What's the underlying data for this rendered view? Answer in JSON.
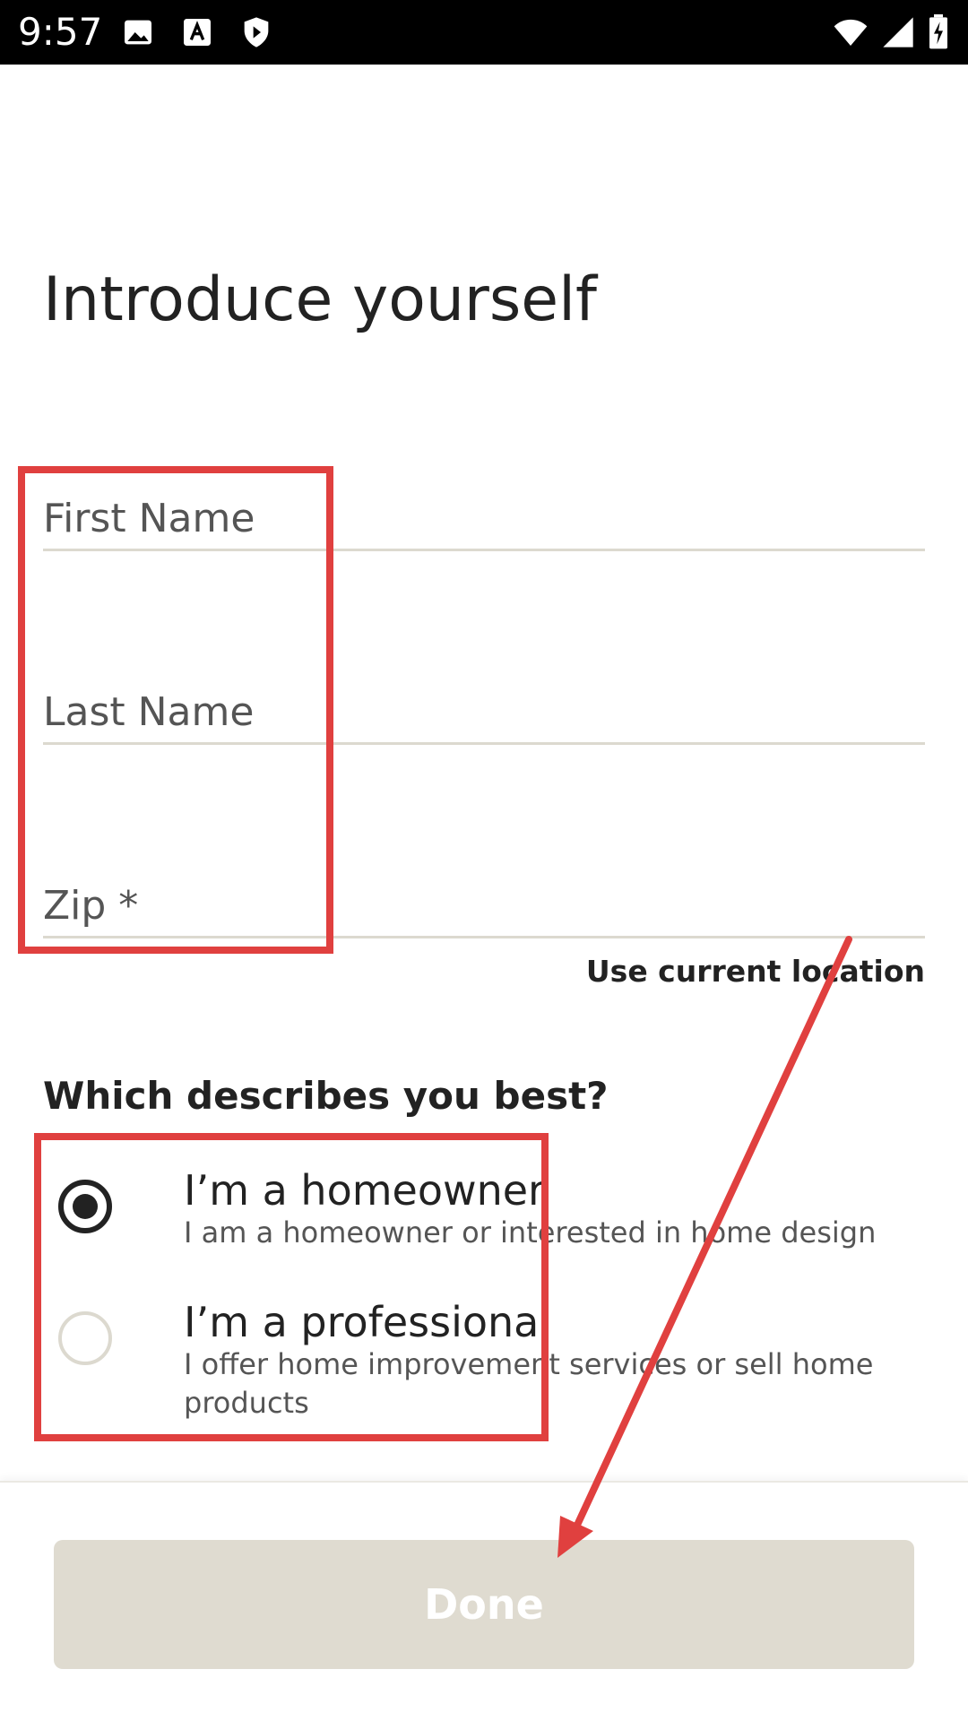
{
  "status_bar": {
    "time": "9:57",
    "left_icons": [
      "image-icon",
      "text-a-icon",
      "shield-play-icon"
    ],
    "right_icons": [
      "wifi-icon",
      "signal-icon",
      "battery-charging-icon"
    ]
  },
  "page": {
    "title": "Introduce yourself"
  },
  "form": {
    "first_name": {
      "label": "First Name",
      "value": ""
    },
    "last_name": {
      "label": "Last Name",
      "value": ""
    },
    "zip": {
      "label": "Zip *",
      "value": ""
    },
    "use_location_label": "Use current location"
  },
  "role": {
    "question": "Which describes you best?",
    "options": [
      {
        "title": "I’m a homeowner",
        "description": "I am a homeowner or interested in home design",
        "selected": true
      },
      {
        "title": "I’m a professional",
        "description": "I offer home improvement services or sell home products",
        "selected": false
      }
    ]
  },
  "footer": {
    "done_label": "Done",
    "done_bg": "#dfdbd0"
  },
  "annotations": {
    "color": "#e0403f"
  }
}
